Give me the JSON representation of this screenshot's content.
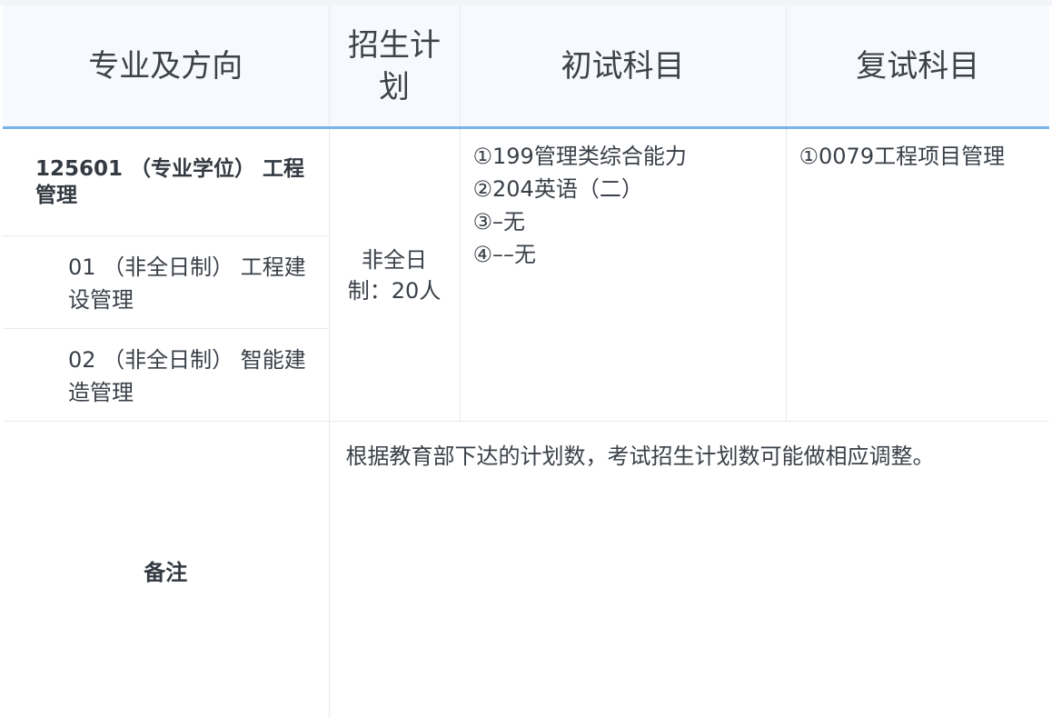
{
  "header": {
    "col_major": "专业及方向",
    "col_plan": "招生计划",
    "col_initial": "初试科目",
    "col_retest": "复试科目"
  },
  "program": {
    "title": "125601 （专业学位） 工程管理",
    "directions": [
      "01 （非全日制） 工程建设管理",
      "02 （非全日制） 智能建造管理"
    ],
    "plan": "非全日制：20人",
    "initial_subjects": [
      "①199管理类综合能力",
      "②204英语（二）",
      "③–无",
      "④––无"
    ],
    "retest_subjects": [
      "①0079工程项目管理"
    ]
  },
  "remark": {
    "label": "备注",
    "text": "根据教育部下达的计划数，考试招生计划数可能做相应调整。"
  }
}
